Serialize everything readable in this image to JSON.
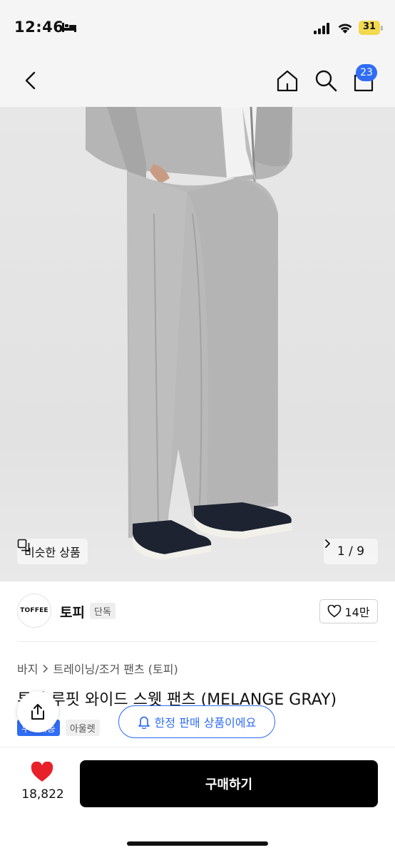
{
  "status": {
    "time": "12:46",
    "battery": "31"
  },
  "nav": {
    "cart_count": "23"
  },
  "image": {
    "similar_label": "비슷한 상품",
    "counter": "1 / 9"
  },
  "brand": {
    "logo_text": "TOFFEE",
    "name": "토피",
    "tag": "단독",
    "likes": "14만"
  },
  "breadcrumb": {
    "items": [
      "바지",
      "트레이닝/조거 팬츠 (토피)"
    ]
  },
  "product": {
    "title": "투턱 루핏 와이드 스웻 팬츠 (MELANGE GRAY)",
    "tag_free": "무료배송",
    "tag_outlet": "아울렛"
  },
  "limited": {
    "label": "한정 판매 상품이에요"
  },
  "bottom": {
    "wish_count": "18,822",
    "buy_label": "구매하기"
  },
  "colors": {
    "accent": "#2f6df5",
    "heart": "#e8202a",
    "buy": "#000000"
  }
}
